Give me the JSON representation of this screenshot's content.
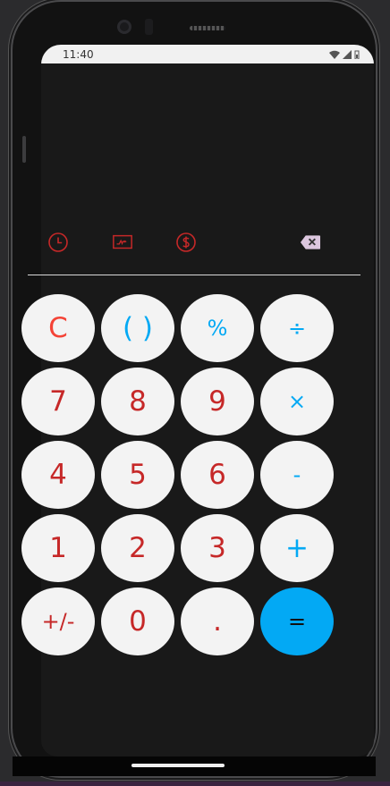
{
  "status": {
    "time": "11:40"
  },
  "icons": {
    "history": "clock-icon",
    "converter": "unit-converter-icon",
    "currency": "currency-dollar-icon",
    "backspace": "backspace-icon"
  },
  "colors": {
    "digit": "#c62828",
    "operator": "#03a9f4",
    "clear": "#f44336",
    "equals_bg": "#03a9f4",
    "key_bg": "#f3f3f3",
    "screen_bg": "#191919"
  },
  "keys": [
    {
      "label": "C"
    },
    {
      "label": "( )"
    },
    {
      "label": "%"
    },
    {
      "label": "÷"
    },
    {
      "label": "7"
    },
    {
      "label": "8"
    },
    {
      "label": "9"
    },
    {
      "label": "×"
    },
    {
      "label": "4"
    },
    {
      "label": "5"
    },
    {
      "label": "6"
    },
    {
      "label": "-"
    },
    {
      "label": "1"
    },
    {
      "label": "2"
    },
    {
      "label": "3"
    },
    {
      "label": "+"
    },
    {
      "label": "+/-"
    },
    {
      "label": "0"
    },
    {
      "label": "."
    },
    {
      "label": "="
    }
  ]
}
